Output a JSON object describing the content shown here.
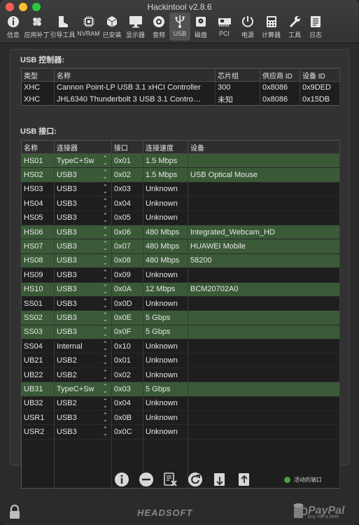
{
  "window": {
    "title": "Hackintool v2.8.6"
  },
  "toolbar": [
    {
      "label": "信息",
      "icon": "info-icon"
    },
    {
      "label": "应用补丁",
      "icon": "patch-icon"
    },
    {
      "label": "引导工具",
      "icon": "boot-icon"
    },
    {
      "label": "NVRAM",
      "icon": "chip-icon"
    },
    {
      "label": "已安装",
      "icon": "installed-icon"
    },
    {
      "label": "显示器",
      "icon": "display-icon"
    },
    {
      "label": "音频",
      "icon": "audio-icon"
    },
    {
      "label": "USB",
      "icon": "usb-icon",
      "selected": true
    },
    {
      "label": "磁盘",
      "icon": "disk-icon"
    },
    {
      "label": "PCI",
      "icon": "pci-icon"
    },
    {
      "label": "电源",
      "icon": "power-icon"
    },
    {
      "label": "计算器",
      "icon": "calculator-icon"
    },
    {
      "label": "工具",
      "icon": "tools-icon"
    },
    {
      "label": "日志",
      "icon": "log-icon"
    }
  ],
  "controllers": {
    "title": "USB 控制器:",
    "headers": [
      "类型",
      "名称",
      "芯片组",
      "供应商 ID",
      "设备 ID"
    ],
    "rows": [
      [
        "XHC",
        "Cannon Point-LP USB 3.1 xHCI Controller",
        "300",
        "0x8086",
        "0x9DED"
      ],
      [
        "XHC",
        "JHL6340 Thunderbolt 3 USB 3.1 Contro…",
        "未知",
        "0x8086",
        "0x15DB"
      ]
    ]
  },
  "ports": {
    "title": "USB 接口:",
    "headers": [
      "名称",
      "连接器",
      "接口",
      "连接速度",
      "设备"
    ],
    "rows": [
      {
        "name": "HS01",
        "connector": "TypeC+Sw",
        "port": "0x01",
        "speed": "1.5 Mbps",
        "device": "",
        "active": true
      },
      {
        "name": "HS02",
        "connector": "USB3",
        "port": "0x02",
        "speed": "1.5 Mbps",
        "device": "USB Optical Mouse",
        "active": true
      },
      {
        "name": "HS03",
        "connector": "USB3",
        "port": "0x03",
        "speed": "Unknown",
        "device": "",
        "active": false
      },
      {
        "name": "HS04",
        "connector": "USB3",
        "port": "0x04",
        "speed": "Unknown",
        "device": "",
        "active": false
      },
      {
        "name": "HS05",
        "connector": "USB3",
        "port": "0x05",
        "speed": "Unknown",
        "device": "",
        "active": false
      },
      {
        "name": "HS06",
        "connector": "USB3",
        "port": "0x06",
        "speed": "480 Mbps",
        "device": "Integrated_Webcam_HD",
        "active": true
      },
      {
        "name": "HS07",
        "connector": "USB3",
        "port": "0x07",
        "speed": "480 Mbps",
        "device": "HUAWEI Mobile",
        "active": true
      },
      {
        "name": "HS08",
        "connector": "USB3",
        "port": "0x08",
        "speed": "480 Mbps",
        "device": "58200",
        "active": true
      },
      {
        "name": "HS09",
        "connector": "USB3",
        "port": "0x09",
        "speed": "Unknown",
        "device": "",
        "active": false
      },
      {
        "name": "HS10",
        "connector": "USB3",
        "port": "0x0A",
        "speed": "12 Mbps",
        "device": "BCM20702A0",
        "active": true
      },
      {
        "name": "SS01",
        "connector": "USB3",
        "port": "0x0D",
        "speed": "Unknown",
        "device": "",
        "active": false
      },
      {
        "name": "SS02",
        "connector": "USB3",
        "port": "0x0E",
        "speed": "5 Gbps",
        "device": "",
        "active": true
      },
      {
        "name": "SS03",
        "connector": "USB3",
        "port": "0x0F",
        "speed": "5 Gbps",
        "device": "",
        "active": true
      },
      {
        "name": "SS04",
        "connector": "Internal",
        "port": "0x10",
        "speed": "Unknown",
        "device": "",
        "active": false
      },
      {
        "name": "UB21",
        "connector": "USB2",
        "port": "0x01",
        "speed": "Unknown",
        "device": "",
        "active": false
      },
      {
        "name": "UB22",
        "connector": "USB2",
        "port": "0x02",
        "speed": "Unknown",
        "device": "",
        "active": false
      },
      {
        "name": "UB31",
        "connector": "TypeC+Sw",
        "port": "0x03",
        "speed": "5 Gbps",
        "device": "",
        "active": true
      },
      {
        "name": "UB32",
        "connector": "USB2",
        "port": "0x04",
        "speed": "Unknown",
        "device": "",
        "active": false
      },
      {
        "name": "USR1",
        "connector": "USB3",
        "port": "0x0B",
        "speed": "Unknown",
        "device": "",
        "active": false
      },
      {
        "name": "USR2",
        "connector": "USB3",
        "port": "0x0C",
        "speed": "Unknown",
        "device": "",
        "active": false
      }
    ]
  },
  "actions": [
    {
      "icon": "info-icon"
    },
    {
      "icon": "remove-icon"
    },
    {
      "icon": "clear-icon"
    },
    {
      "icon": "refresh-icon"
    },
    {
      "icon": "import-icon"
    },
    {
      "icon": "export-icon"
    }
  ],
  "legend": {
    "label": "活动的端口",
    "color": "#46a04a"
  },
  "footer": {
    "brand": "HEADSOFT",
    "paypal": "PayPal",
    "paypal_sub": "buy me a beer"
  }
}
